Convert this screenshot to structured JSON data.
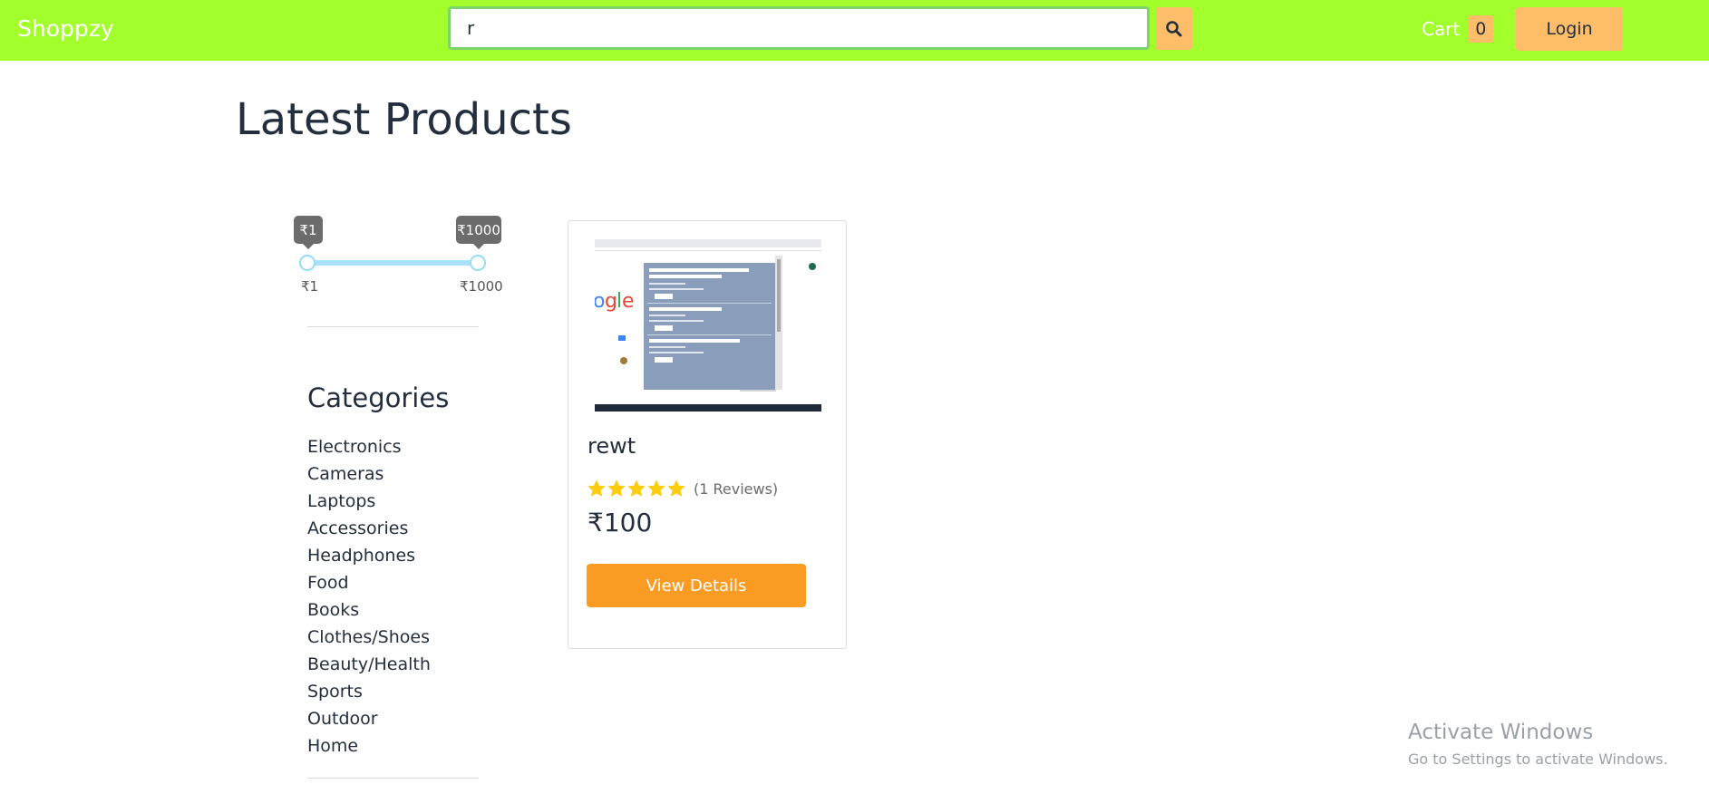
{
  "colors": {
    "navbar": "#a3ff2b",
    "accent": "#febd69",
    "primary_button": "#fa9c23",
    "text": "#232f3e"
  },
  "header": {
    "brand": "Shoppzy",
    "search": {
      "value": "r",
      "placeholder": ""
    },
    "search_icon": "search-icon",
    "cart_label": "Cart",
    "cart_count": "0",
    "login_label": "Login"
  },
  "main": {
    "title": "Latest Products",
    "price_filter": {
      "min_value": "₹1",
      "max_value": "₹1000",
      "min_mark": "₹1",
      "max_mark": "₹1000"
    },
    "categories": {
      "title": "Categories",
      "items": [
        "Electronics",
        "Cameras",
        "Laptops",
        "Accessories",
        "Headphones",
        "Food",
        "Books",
        "Clothes/Shoes",
        "Beauty/Health",
        "Sports",
        "Outdoor",
        "Home"
      ]
    },
    "products": [
      {
        "name": "rewt",
        "rating": 5,
        "reviews": "(1 Reviews)",
        "price": "₹100",
        "button": "View Details"
      }
    ]
  },
  "watermark": {
    "title": "Activate Windows",
    "subtitle": "Go to Settings to activate Windows."
  }
}
